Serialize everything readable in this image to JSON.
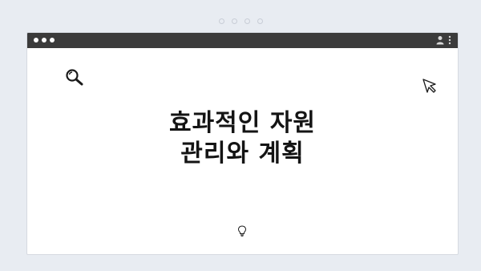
{
  "slide": {
    "title_line1": "효과적인 자원",
    "title_line2": "관리와 계획"
  },
  "icons": {
    "top_left": "search-icon",
    "top_right": "cursor-icon",
    "bottom": "lightbulb-icon",
    "titlebar_right": [
      "user-icon",
      "more-vertical-icon"
    ]
  },
  "colors": {
    "background": "#e8ecf2",
    "titlebar": "#3b3b3b",
    "window": "#ffffff",
    "text": "#141414"
  }
}
